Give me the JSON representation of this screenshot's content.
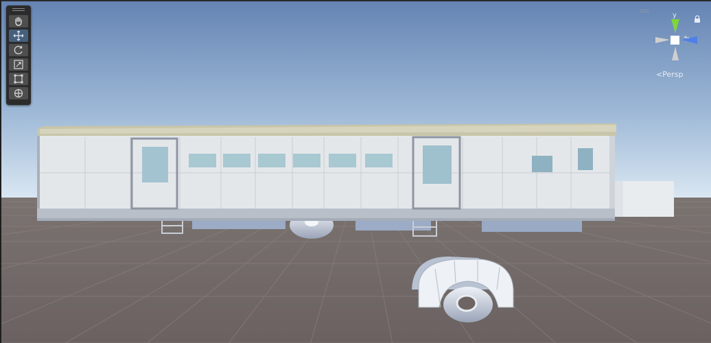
{
  "scene_view": {
    "toolbar": {
      "tools": [
        {
          "name": "hand-tool",
          "icon": "hand-icon",
          "active": false
        },
        {
          "name": "move-tool",
          "icon": "move-arrows-icon",
          "active": true
        },
        {
          "name": "rotate-tool",
          "icon": "rotate-icon",
          "active": false
        },
        {
          "name": "scale-tool",
          "icon": "scale-icon",
          "active": false
        },
        {
          "name": "rect-tool",
          "icon": "rect-transform-icon",
          "active": false
        },
        {
          "name": "transform-tool",
          "icon": "transform-icon",
          "active": false
        }
      ]
    },
    "gizmo": {
      "y_axis_label": "y",
      "z_axis_label": "z",
      "projection_label": "Persp",
      "y_color": "#7fd63a",
      "z_color": "#4f7fe8",
      "neutral_color": "#cfcfcf"
    },
    "colors": {
      "sky_top": "#6b8dbb",
      "sky_horizon": "#d7e6f2",
      "ground": "#6e6563",
      "grid_line": "#847b79",
      "trailer_body": "#e3e6ea",
      "trailer_roof": "#bdbaa0",
      "window": "#9fc1cf"
    }
  }
}
